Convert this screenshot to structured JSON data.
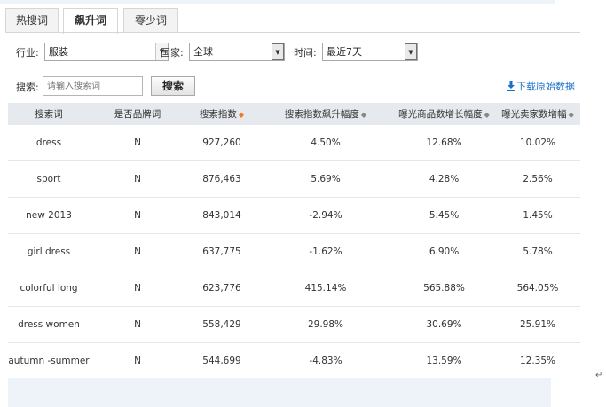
{
  "tabs": [
    {
      "label": "热搜词",
      "active": false
    },
    {
      "label": "飙升词",
      "active": true
    },
    {
      "label": "零少词",
      "active": false
    }
  ],
  "filters": {
    "industry_label": "行业:",
    "industry_value": "服装",
    "country_label": "国家:",
    "country_value": "全球",
    "time_label": "时间:",
    "time_value": "最近7天"
  },
  "search": {
    "label": "搜索:",
    "placeholder": "请输入搜索词",
    "button": "搜索",
    "download": "下载原始数据"
  },
  "table": {
    "headers": [
      "搜索词",
      "是否品牌词",
      "搜索指数",
      "搜索指数飙升幅度",
      "曝光商品数增长幅度",
      "曝光卖家数增幅"
    ],
    "rows": [
      [
        "dress",
        "N",
        "927,260",
        "4.50%",
        "12.68%",
        "10.02%"
      ],
      [
        "sport",
        "N",
        "876,463",
        "5.69%",
        "4.28%",
        "2.56%"
      ],
      [
        "new 2013",
        "N",
        "843,014",
        "-2.94%",
        "5.45%",
        "1.45%"
      ],
      [
        "girl dress",
        "N",
        "637,775",
        "-1.62%",
        "6.90%",
        "5.78%"
      ],
      [
        "colorful long",
        "N",
        "623,776",
        "415.14%",
        "565.88%",
        "564.05%"
      ],
      [
        "dress women",
        "N",
        "558,429",
        "29.98%",
        "30.69%",
        "25.91%"
      ],
      [
        "autumn -summer",
        "N",
        "544,699",
        "-4.83%",
        "13.59%",
        "12.35%"
      ]
    ]
  },
  "colors": {
    "accent": "#f07b22",
    "link": "#1a6fc9",
    "header_bg": "#e6eaef"
  },
  "return_mark": "↵"
}
